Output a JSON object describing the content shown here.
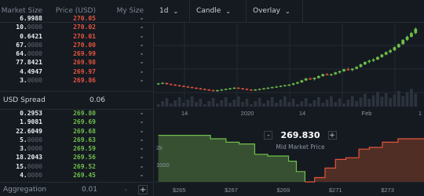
{
  "orderbook": {
    "headers": {
      "size": "Market Size",
      "price": "Price (USD)",
      "my_size": "My Size"
    },
    "asks": [
      {
        "size_main": "6.9988",
        "size_dim": "",
        "price": "270.05",
        "my": "-"
      },
      {
        "size_main": "10.",
        "size_dim": "0000",
        "price": "270.02",
        "my": "-"
      },
      {
        "size_main": "0.6421",
        "size_dim": "",
        "price": "270.01",
        "my": "-"
      },
      {
        "size_main": "67.",
        "size_dim": "0000",
        "price": "270.00",
        "my": "-"
      },
      {
        "size_main": "64.",
        "size_dim": "0000",
        "price": "269.99",
        "my": "-"
      },
      {
        "size_main": "77.8421",
        "size_dim": "",
        "price": "269.98",
        "my": "-"
      },
      {
        "size_main": "4.4947",
        "size_dim": "",
        "price": "269.97",
        "my": "-"
      },
      {
        "size_main": "3.",
        "size_dim": "0000",
        "price": "269.86",
        "my": "-"
      }
    ],
    "spread": {
      "label": "USD Spread",
      "value": "0.06"
    },
    "bids": [
      {
        "size_main": "0.2953",
        "size_dim": "",
        "price": "269.80",
        "my": "-"
      },
      {
        "size_main": "1.9081",
        "size_dim": "",
        "price": "269.69",
        "my": "-"
      },
      {
        "size_main": "22.6049",
        "size_dim": "",
        "price": "269.68",
        "my": "-"
      },
      {
        "size_main": "5.",
        "size_dim": "0000",
        "price": "269.63",
        "my": "-"
      },
      {
        "size_main": "3.",
        "size_dim": "0000",
        "price": "269.59",
        "my": "-"
      },
      {
        "size_main": "18.2043",
        "size_dim": "",
        "price": "269.56",
        "my": "-"
      },
      {
        "size_main": "15.",
        "size_dim": "0000",
        "price": "269.52",
        "my": "-"
      },
      {
        "size_main": "4.",
        "size_dim": "0000",
        "price": "269.45",
        "my": "-"
      }
    ],
    "aggregation": {
      "label": "Aggregation",
      "value": "0.01",
      "minus": "-",
      "plus": "+"
    }
  },
  "toolbar": {
    "interval": "1d",
    "style": "Candle",
    "overlay": "Overlay"
  },
  "chart_data": [
    {
      "type": "candlestick",
      "x_ticks": [
        "14",
        "2020",
        "14",
        "Feb",
        "1"
      ],
      "series": [
        {
          "name": "",
          "values": [
            [
              180,
              181,
              178,
              180
            ],
            [
              180,
              182,
              179,
              181
            ],
            [
              181,
              181,
              178,
              179
            ],
            [
              179,
              180,
              177,
              178
            ],
            [
              178,
              179,
              176,
              177
            ],
            [
              177,
              178,
              175,
              176
            ],
            [
              176,
              177,
              174,
              175
            ],
            [
              175,
              176,
              173,
              174
            ],
            [
              174,
              175,
              172,
              173
            ],
            [
              173,
              174,
              171,
              172
            ],
            [
              172,
              173,
              170,
              171
            ],
            [
              171,
              172,
              169,
              170
            ],
            [
              170,
              171,
              168,
              169
            ],
            [
              169,
              170,
              167,
              168
            ],
            [
              168,
              170,
              167,
              169
            ],
            [
              169,
              171,
              168,
              170
            ],
            [
              170,
              172,
              169,
              171
            ],
            [
              171,
              173,
              170,
              172
            ],
            [
              172,
              174,
              171,
              173
            ],
            [
              173,
              174,
              171,
              172
            ],
            [
              172,
              173,
              170,
              171
            ],
            [
              171,
              172,
              169,
              170
            ],
            [
              170,
              171,
              168,
              169
            ],
            [
              169,
              171,
              168,
              170
            ],
            [
              170,
              172,
              169,
              171
            ],
            [
              171,
              173,
              170,
              172
            ],
            [
              172,
              174,
              171,
              173
            ],
            [
              173,
              175,
              172,
              174
            ],
            [
              174,
              176,
              173,
              175
            ],
            [
              175,
              177,
              174,
              176
            ],
            [
              176,
              178,
              175,
              177
            ],
            [
              177,
              179,
              176,
              178
            ],
            [
              178,
              181,
              177,
              180
            ],
            [
              180,
              183,
              179,
              182
            ],
            [
              182,
              186,
              181,
              185
            ],
            [
              185,
              189,
              184,
              188
            ],
            [
              188,
              190,
              186,
              187
            ],
            [
              187,
              190,
              185,
              189
            ],
            [
              189,
              193,
              188,
              192
            ],
            [
              192,
              196,
              191,
              195
            ],
            [
              195,
              197,
              193,
              194
            ],
            [
              194,
              196,
              192,
              195
            ],
            [
              195,
              199,
              194,
              198
            ],
            [
              198,
              201,
              196,
              200
            ],
            [
              200,
              204,
              199,
              203
            ],
            [
              203,
              206,
              201,
              202
            ],
            [
              202,
              205,
              200,
              204
            ],
            [
              204,
              208,
              203,
              207
            ],
            [
              207,
              212,
              206,
              211
            ],
            [
              211,
              216,
              210,
              215
            ],
            [
              215,
              219,
              213,
              217
            ],
            [
              217,
              221,
              215,
              219
            ],
            [
              219,
              224,
              218,
              223
            ],
            [
              223,
              228,
              222,
              227
            ],
            [
              227,
              232,
              226,
              231
            ],
            [
              231,
              236,
              229,
              234
            ],
            [
              234,
              240,
              233,
              239
            ],
            [
              239,
              245,
              238,
              244
            ],
            [
              244,
              252,
              243,
              251
            ],
            [
              251,
              258,
              249,
              256
            ],
            [
              256,
              264,
              255,
              262
            ],
            [
              262,
              271,
              260,
              269
            ]
          ]
        }
      ]
    },
    {
      "type": "area",
      "x_ticks": [
        "$265",
        "$267",
        "$269",
        "$271",
        "$273"
      ],
      "y_ticks": [
        "2k",
        "1000"
      ],
      "mid_price": "269.830",
      "mid_label": "Mid Market Price",
      "mid_minus": "-",
      "mid_plus": "+",
      "series": [
        {
          "name": "",
          "side": "bid",
          "x": [
            264.2,
            265.5,
            266.2,
            266.8,
            267.3,
            267.9,
            268.4,
            268.8,
            269.2,
            269.5,
            269.83
          ],
          "y": [
            2700,
            2700,
            2500,
            2300,
            2200,
            1600,
            1500,
            1500,
            1200,
            600,
            0
          ]
        },
        {
          "name": "",
          "side": "ask",
          "x": [
            269.83,
            270.2,
            270.6,
            271.0,
            271.4,
            271.9,
            272.3,
            272.8,
            273.4,
            274.4
          ],
          "y": [
            0,
            250,
            800,
            1300,
            1400,
            1900,
            2000,
            2300,
            2500,
            2500
          ]
        }
      ]
    }
  ],
  "colors": {
    "bid": "#6fbf4a",
    "ask": "#e5533d",
    "background": "#151a21"
  }
}
